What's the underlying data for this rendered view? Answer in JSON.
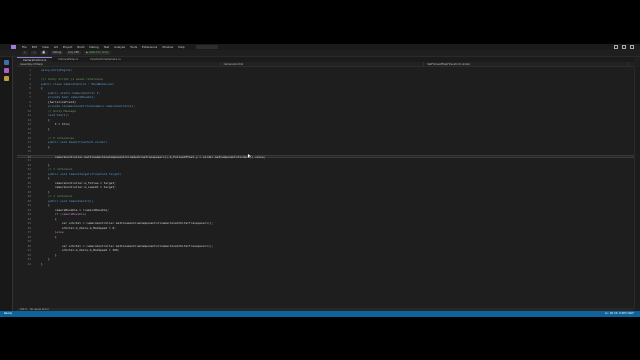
{
  "menubar": {
    "items": [
      "File",
      "Edit",
      "View",
      "Git",
      "Project",
      "Build",
      "Debug",
      "Test",
      "Analyze",
      "Tools",
      "Extensions",
      "Window",
      "Help"
    ],
    "search_placeholder": "Search"
  },
  "toolbar": {
    "config": "Debug",
    "platform": "Any CPU",
    "run_label": "▶ Attach to Unity",
    "items": [
      "←",
      "→",
      "💾"
    ]
  },
  "tabs": [
    {
      "label": "CameraControl.cs",
      "active": true
    },
    {
      "label": "CameraFade.cs",
      "active": false
    },
    {
      "label": "CinemachineCamera.cs",
      "active": false
    }
  ],
  "navbar": {
    "project": "Assembly-CSharp",
    "class": "CameraControl",
    "member": "SetFollowOffset(Transform slider)"
  },
  "code_lines": [
    {
      "n": "1",
      "t": "using UnityEngine;",
      "cls": "kw"
    },
    {
      "n": "2",
      "t": "",
      "cls": ""
    },
    {
      "n": "3",
      "t": "/// Unity Script (1 asset reference)",
      "cls": "cm"
    },
    {
      "n": "4",
      "t": "public class CameraControl : MonoBehaviour",
      "cls": "kw"
    },
    {
      "n": "5",
      "t": "{",
      "cls": ""
    },
    {
      "n": "6",
      "t": "    public static CameraControl I;",
      "cls": "kw"
    },
    {
      "n": "7",
      "t": "    private bool cameraMovable;",
      "cls": "kw"
    },
    {
      "n": "8",
      "t": "    [SerializeField]",
      "cls": ""
    },
    {
      "n": "9",
      "t": "    private CinemachineVirtualCamera cameraController;",
      "cls": "kw"
    },
    {
      "n": "10",
      "t": "    // Unity Message",
      "cls": "cm"
    },
    {
      "n": "11",
      "t": "    void Start()",
      "cls": "kw"
    },
    {
      "n": "12",
      "t": "    {",
      "cls": ""
    },
    {
      "n": "13",
      "t": "        I = this;",
      "cls": ""
    },
    {
      "n": "14",
      "t": "    }",
      "cls": ""
    },
    {
      "n": "15",
      "t": "",
      "cls": ""
    },
    {
      "n": "16",
      "t": "    // 0 references",
      "cls": "cm"
    },
    {
      "n": "17",
      "t": "    public void Zoom(Transform slider)",
      "cls": "kw"
    },
    {
      "n": "18",
      "t": "    {",
      "cls": ""
    },
    {
      "n": "19",
      "t": "",
      "cls": ""
    },
    {
      "n": "20",
      "t": "        cameraController.GetCinemachineComponent<CinemachineTransposer>().m_FollowOffset.y = slider.GetComponent<Slider>().value;",
      "cls": "",
      "hl": true
    },
    {
      "n": "21",
      "t": "",
      "cls": ""
    },
    {
      "n": "22",
      "t": "    }",
      "cls": ""
    },
    {
      "n": "23",
      "t": "    // 1 reference",
      "cls": "cm"
    },
    {
      "n": "24",
      "t": "    public void CameraTarget(Transform target)",
      "cls": "kw"
    },
    {
      "n": "25",
      "t": "    {",
      "cls": ""
    },
    {
      "n": "26",
      "t": "        cameraController.m_Follow = target;",
      "cls": ""
    },
    {
      "n": "27",
      "t": "        cameraController.m_LookAt = target;",
      "cls": ""
    },
    {
      "n": "28",
      "t": "    }",
      "cls": ""
    },
    {
      "n": "29",
      "t": "    // 1 reference",
      "cls": "cm"
    },
    {
      "n": "30",
      "t": "    public void CameraSwitch()",
      "cls": "kw"
    },
    {
      "n": "31",
      "t": "    {",
      "cls": ""
    },
    {
      "n": "32",
      "t": "        cameraMovable = !cameraMovable;",
      "cls": ""
    },
    {
      "n": "33",
      "t": "        if (cameraMovable)",
      "cls": "ar"
    },
    {
      "n": "34",
      "t": "        {",
      "cls": ""
    },
    {
      "n": "35",
      "t": "            var orbital = cameraController.GetCinemachineComponent<CinemachineOrbitalTransposer>();",
      "cls": ""
    },
    {
      "n": "36",
      "t": "            orbital.m_XAxis.m_MaxSpeed = 0;",
      "cls": ""
    },
    {
      "n": "37",
      "t": "        }else",
      "cls": "ar"
    },
    {
      "n": "38",
      "t": "        {",
      "cls": ""
    },
    {
      "n": "39",
      "t": "",
      "cls": ""
    },
    {
      "n": "40",
      "t": "            var orbital = cameraController.GetCinemachineComponent<CinemachineOrbitalTransposer>();",
      "cls": ""
    },
    {
      "n": "41",
      "t": "            orbital.m_XAxis.m_MaxSpeed = 300;",
      "cls": ""
    },
    {
      "n": "42",
      "t": "        }",
      "cls": ""
    },
    {
      "n": "43",
      "t": "    }",
      "cls": ""
    },
    {
      "n": "44",
      "t": "}",
      "cls": ""
    }
  ],
  "hscroll": {
    "zoom": "100 %",
    "issues": "No issues found"
  },
  "statusbar": {
    "left": "Ready",
    "right": "Ln: 20  Ch: 9  SPC  CRLF"
  },
  "colors": {
    "accent": "#9b7ed9",
    "status": "#0e639c"
  }
}
